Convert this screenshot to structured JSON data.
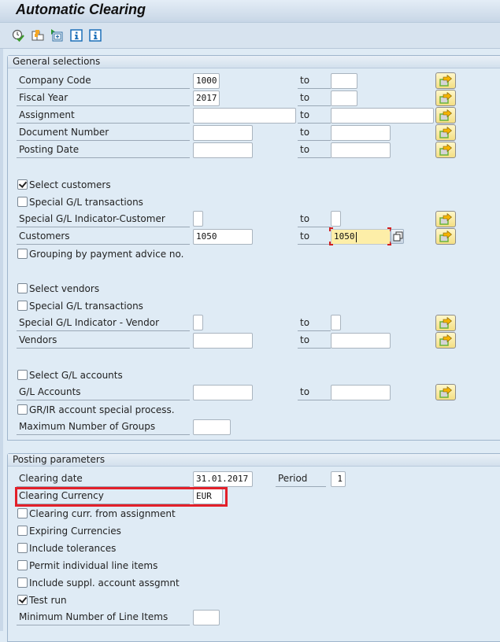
{
  "window": {
    "title": "Automatic Clearing"
  },
  "toolbar": {
    "icons": [
      {
        "name": "execute-icon",
        "tooltip": ""
      },
      {
        "name": "get-variant-icon",
        "tooltip": ""
      },
      {
        "name": "dynamic-selections-icon",
        "tooltip": ""
      },
      {
        "name": "info-icon",
        "tooltip": ""
      },
      {
        "name": "info-icon",
        "tooltip": ""
      }
    ]
  },
  "general_selections": {
    "title": "General selections",
    "to_label": "to",
    "company_code": {
      "label": "Company Code",
      "from": "1000",
      "to": ""
    },
    "fiscal_year": {
      "label": "Fiscal Year",
      "from": "2017",
      "to": ""
    },
    "assignment": {
      "label": "Assignment",
      "from": "",
      "to": ""
    },
    "document_number": {
      "label": "Document Number",
      "from": "",
      "to": ""
    },
    "posting_date": {
      "label": "Posting Date",
      "from": "",
      "to": ""
    },
    "select_customers": {
      "label": "Select customers",
      "checked": true
    },
    "cust_special_gl_transactions": {
      "label": "Special G/L transactions",
      "checked": false
    },
    "special_gl_indicator_customer": {
      "label": "Special G/L Indicator-Customer",
      "from": "",
      "to": ""
    },
    "customers": {
      "label": "Customers",
      "from": "1050",
      "to": "1050"
    },
    "grouping_payment_advice": {
      "label": "Grouping by payment advice no.",
      "checked": false
    },
    "select_vendors": {
      "label": "Select vendors",
      "checked": false
    },
    "vend_special_gl_transactions": {
      "label": "Special G/L transactions",
      "checked": false
    },
    "special_gl_indicator_vendor": {
      "label": "Special G/L Indicator - Vendor",
      "from": "",
      "to": ""
    },
    "vendors": {
      "label": "Vendors",
      "from": "",
      "to": ""
    },
    "select_gl_accounts": {
      "label": "Select G/L accounts",
      "checked": false
    },
    "gl_accounts": {
      "label": "G/L Accounts",
      "from": "",
      "to": ""
    },
    "grir_special_process": {
      "label": "GR/IR account special process.",
      "checked": false
    },
    "max_groups": {
      "label": "Maximum Number of Groups",
      "value": ""
    }
  },
  "posting_parameters": {
    "title": "Posting parameters",
    "clearing_date": {
      "label": "Clearing date",
      "value": "31.01.2017"
    },
    "period": {
      "label": "Period",
      "value": "1"
    },
    "clearing_currency": {
      "label": "Clearing Currency",
      "value": "EUR"
    },
    "clearing_curr_from_assignment": {
      "label": "Clearing curr. from assignment",
      "checked": false
    },
    "expiring_currencies": {
      "label": "Expiring Currencies",
      "checked": false
    },
    "include_tolerances": {
      "label": "Include tolerances",
      "checked": false
    },
    "permit_individual_line_items": {
      "label": "Permit individual line items",
      "checked": false
    },
    "include_suppl_account_assignment": {
      "label": "Include suppl. account assgmnt",
      "checked": false
    },
    "test_run": {
      "label": "Test run",
      "checked": true
    },
    "min_line_items": {
      "label": "Minimum Number of Line Items",
      "value": ""
    }
  },
  "colors": {
    "highlight": "#e3202a",
    "active_field": "#fdeea8",
    "background": "#dfebf5"
  }
}
